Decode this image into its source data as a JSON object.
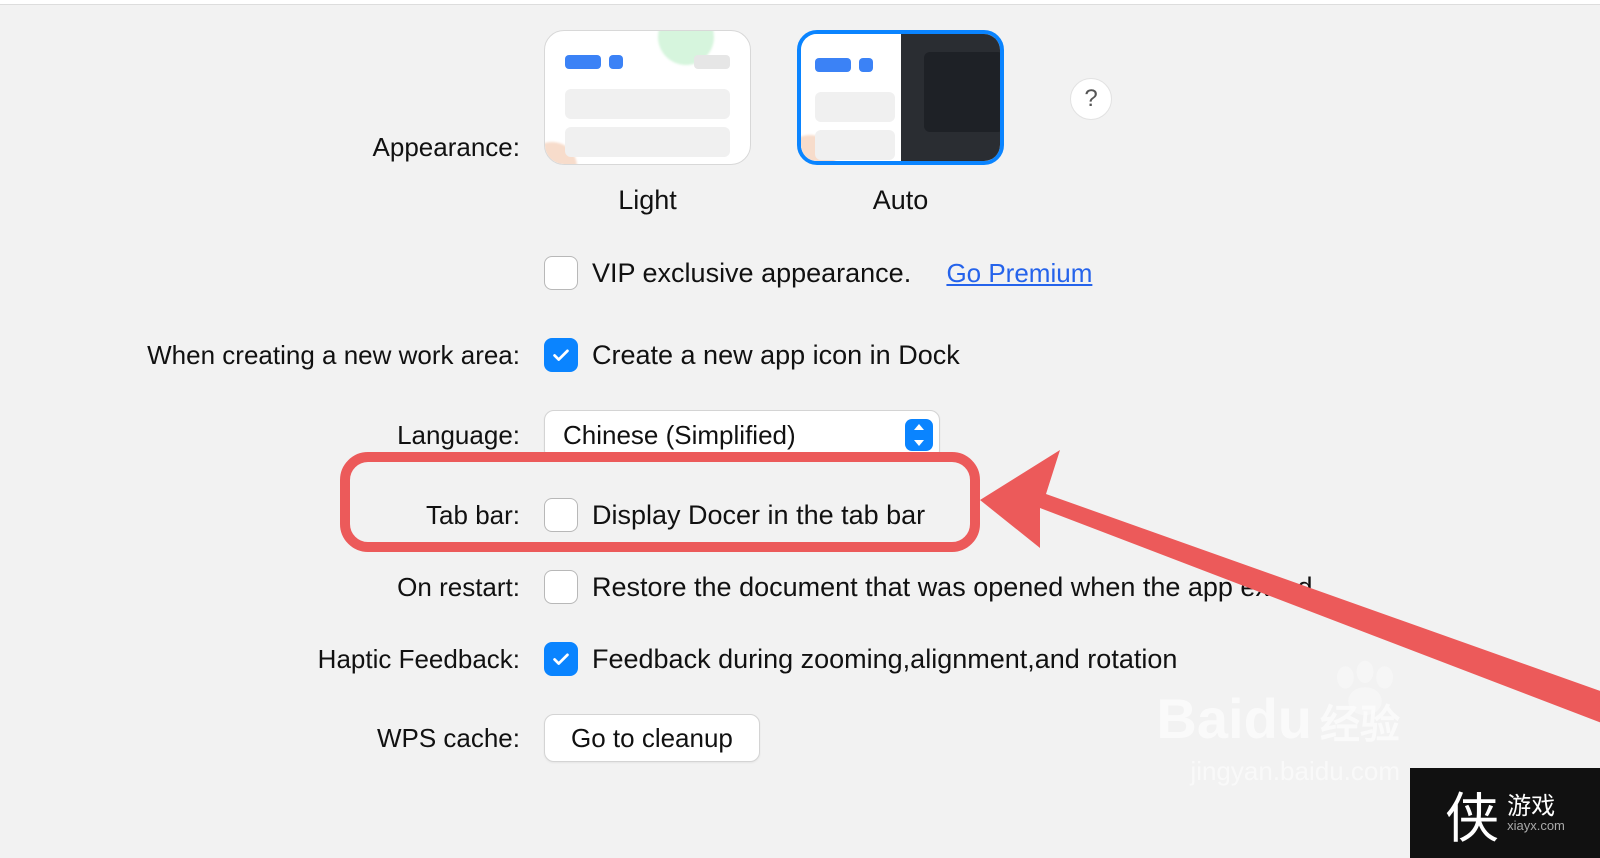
{
  "appearance": {
    "label": "Appearance:",
    "light_label": "Light",
    "auto_label": "Auto",
    "help": "?"
  },
  "vip": {
    "label": "VIP exclusive appearance.",
    "link": "Go Premium"
  },
  "workarea": {
    "label": "When creating a new work area:",
    "option": "Create a new app icon in Dock"
  },
  "language": {
    "label": "Language:",
    "value": "Chinese (Simplified)"
  },
  "tabbar": {
    "label": "Tab bar:",
    "option": "Display Docer in the tab bar"
  },
  "restart": {
    "label": "On restart:",
    "option": "Restore the document that was opened when the app exited"
  },
  "haptic": {
    "label": "Haptic Feedback:",
    "option": "Feedback during zooming,alignment,and rotation"
  },
  "cache": {
    "label": "WPS cache:",
    "button": "Go to cleanup"
  },
  "watermark": {
    "baidu": "Bai",
    "du": "du",
    "jingyan": "经验",
    "url": "jingyan.baidu.com"
  },
  "corner": {
    "xia": "侠",
    "youxi": "游戏",
    "url": "xiayx.com"
  }
}
